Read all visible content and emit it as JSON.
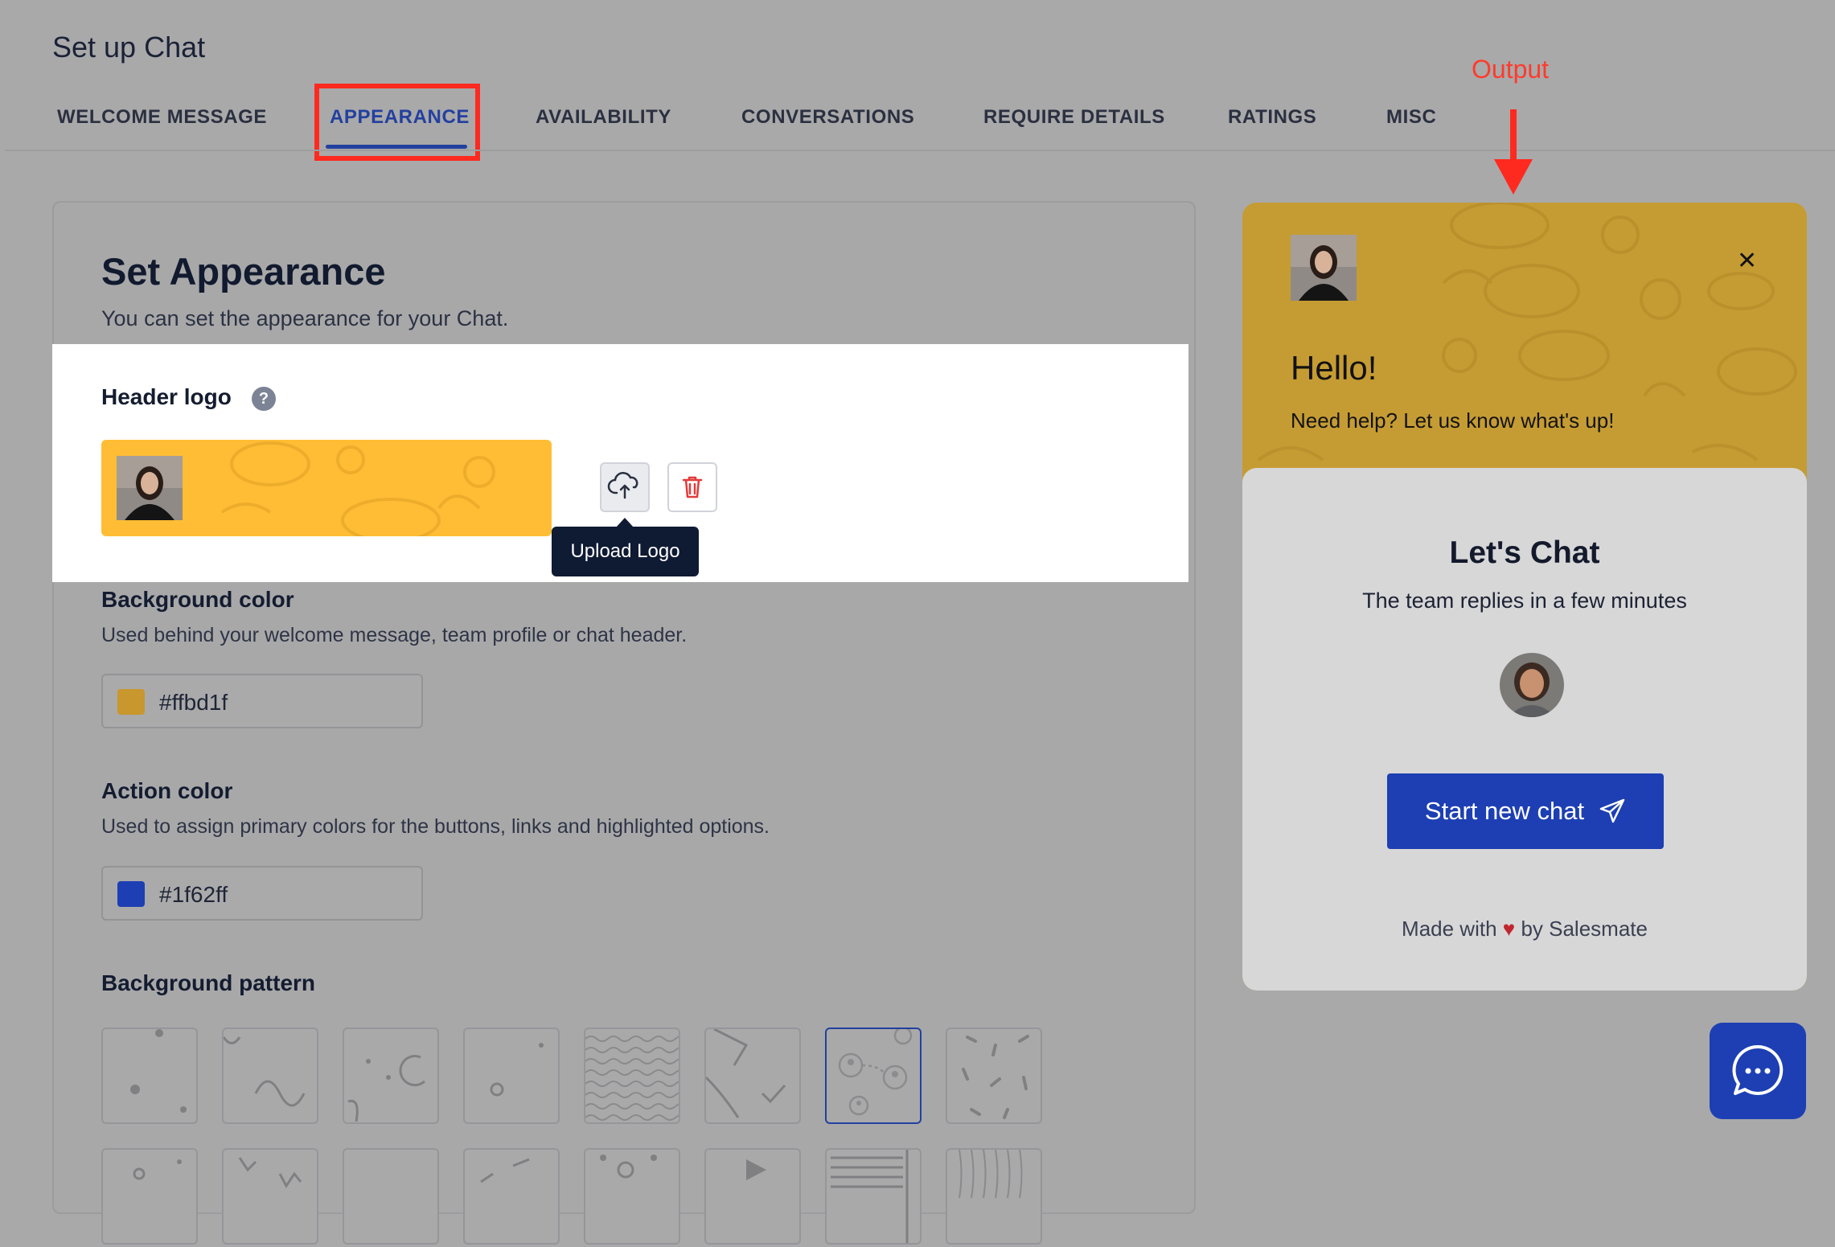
{
  "page": {
    "title": "Set up Chat"
  },
  "tabs": [
    {
      "label": "WELCOME MESSAGE"
    },
    {
      "label": "APPEARANCE",
      "active": true
    },
    {
      "label": "AVAILABILITY"
    },
    {
      "label": "CONVERSATIONS"
    },
    {
      "label": "REQUIRE DETAILS"
    },
    {
      "label": "RATINGS"
    },
    {
      "label": "MISC"
    }
  ],
  "annotation": {
    "output_label": "Output",
    "highlight_color": "#ff2a1f"
  },
  "appearance": {
    "title": "Set Appearance",
    "subtitle": "You can set the appearance for your Chat.",
    "header_logo": {
      "label": "Header logo",
      "help_icon": "question-circle-icon",
      "tooltip": "Upload Logo",
      "upload_icon": "cloud-upload-icon",
      "delete_icon": "trash-icon"
    },
    "background_color": {
      "label": "Background color",
      "description": "Used behind your welcome message, team profile or chat header.",
      "value": "#ffbd1f",
      "swatch": "#c8972e"
    },
    "action_color": {
      "label": "Action color",
      "description": "Used to assign primary colors for the buttons, links and highlighted options.",
      "value": "#1f62ff",
      "swatch": "#1d3fb3"
    },
    "background_pattern": {
      "label": "Background pattern",
      "selected_index": 6
    }
  },
  "widget": {
    "close_icon": "close-icon",
    "hello": "Hello!",
    "help_text": "Need help? Let us know what's up!",
    "lets_chat": "Let's Chat",
    "replies": "The team replies in a few minutes",
    "start_button": "Start new chat",
    "send_icon": "paper-plane-icon",
    "made_with_prefix": "Made with",
    "heart": "♥",
    "made_with_suffix": "by Salesmate"
  },
  "fab": {
    "icon": "chat-bubble-icon"
  }
}
